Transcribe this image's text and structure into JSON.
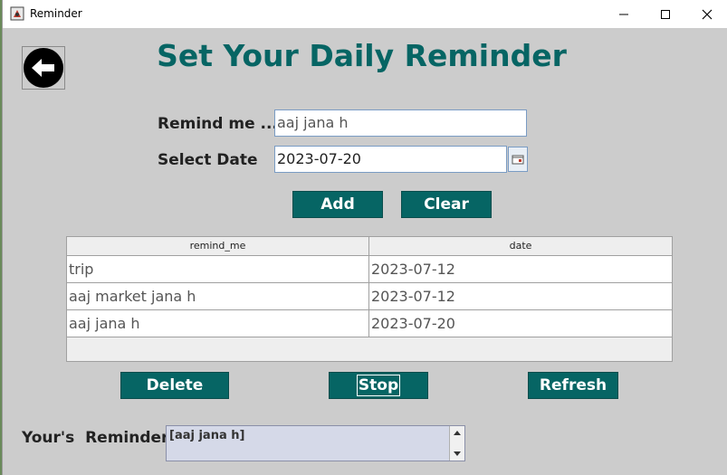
{
  "window": {
    "title": "Reminder"
  },
  "page": {
    "title": "Set Your Daily Reminder"
  },
  "form": {
    "remind_label": "Remind me ...",
    "remind_value": "aaj jana h",
    "date_label": "Select Date",
    "date_value": "2023-07-20"
  },
  "buttons": {
    "add": "Add",
    "clear": "Clear",
    "delete": "Delete",
    "stop": "Stop",
    "refresh": "Refresh"
  },
  "table": {
    "columns": [
      "remind_me",
      "date"
    ],
    "rows": [
      [
        "trip",
        "2023-07-12"
      ],
      [
        "aaj market jana h",
        "2023-07-12"
      ],
      [
        "aaj jana h",
        "2023-07-20"
      ]
    ]
  },
  "reminder": {
    "label": "Your's  Reminder",
    "text": "[aaj jana h]"
  },
  "colors": {
    "accent": "#066564",
    "window_bg": "#cccccc"
  }
}
